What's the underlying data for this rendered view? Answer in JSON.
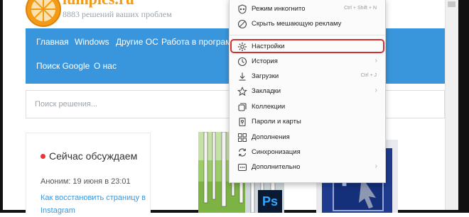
{
  "site": {
    "name": "lumpics.ru",
    "tagline": "8883 решений ваших проблем"
  },
  "nav": {
    "items": [
      "Главная",
      "Windows",
      "Другие ОС",
      "Работа в программ",
      "Поиск Google",
      "О нас"
    ]
  },
  "search": {
    "placeholder": "Поиск решения..."
  },
  "sidebar_card": {
    "title": "Сейчас обсуждаем",
    "author": "Аноним: 19 июня в 23:01",
    "link": "Как восстановить страницу в Instagram"
  },
  "menu": {
    "items": [
      {
        "label": "Режим инкогнито",
        "shortcut": "Ctrl + Shift + N",
        "icon": "incognito-icon"
      },
      {
        "label": "Скрыть мешающую рекламу",
        "icon": "block-icon"
      },
      {
        "label": "Настройки",
        "icon": "gear-icon"
      },
      {
        "label": "История",
        "chevron": "›",
        "icon": "history-icon"
      },
      {
        "label": "Загрузки",
        "shortcut": "Ctrl + J",
        "icon": "download-icon"
      },
      {
        "label": "Закладки",
        "chevron": "›",
        "icon": "star-icon"
      },
      {
        "label": "Коллекции",
        "icon": "collections-icon"
      },
      {
        "label": "Пароли и карты",
        "icon": "key-icon"
      },
      {
        "label": "Дополнения",
        "icon": "extensions-icon"
      },
      {
        "label": "Синхронизация",
        "icon": "sync-icon"
      },
      {
        "label": "Дополнительно",
        "chevron": "›",
        "icon": "more-icon"
      }
    ]
  },
  "thumbnails": {
    "ps_badge": "Ps",
    "pr_letter": "P"
  },
  "colors": {
    "nav_bg": "#3a96dc",
    "brand_orange": "#f29b16",
    "highlight_red": "#d32f2f"
  }
}
